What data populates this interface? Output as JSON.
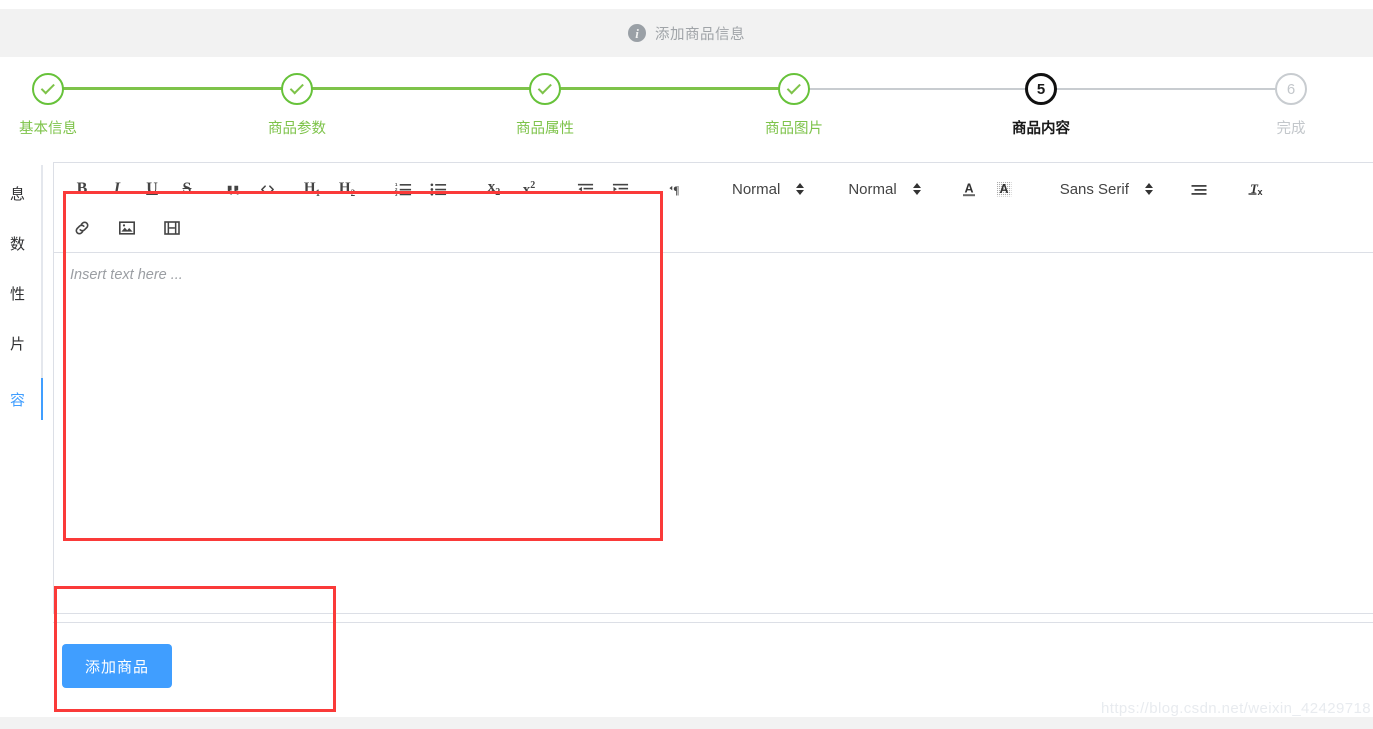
{
  "header": {
    "icon": "info-icon",
    "title": "添加商品信息"
  },
  "steps": [
    {
      "index": "1",
      "label": "基本信息",
      "state": "done"
    },
    {
      "index": "2",
      "label": "商品参数",
      "state": "done"
    },
    {
      "index": "3",
      "label": "商品属性",
      "state": "done"
    },
    {
      "index": "4",
      "label": "商品图片",
      "state": "done"
    },
    {
      "index": "5",
      "label": "商品内容",
      "state": "active"
    },
    {
      "index": "6",
      "label": "完成",
      "state": "pending"
    }
  ],
  "sidebar": {
    "items": [
      {
        "label": "息",
        "active": false
      },
      {
        "label": "数",
        "active": false
      },
      {
        "label": "性",
        "active": false
      },
      {
        "label": "片",
        "active": false
      },
      {
        "label": "容",
        "active": true
      }
    ]
  },
  "toolbar": {
    "bold": "B",
    "italic": "I",
    "underline": "U",
    "strike": "S",
    "blockquote": "“",
    "code_block": "</>",
    "header1": "H1",
    "header2": "H2",
    "list_ordered": "ordered-list-icon",
    "list_bullet": "bullet-list-icon",
    "subscript": "x₂",
    "superscript": "x²",
    "outdent": "outdent-icon",
    "indent": "indent-icon",
    "direction": "text-direction-icon",
    "align_label": "Normal",
    "size_label": "Normal",
    "color_label": "A",
    "background_label": "A",
    "font_label": "Sans Serif",
    "align_menu": "align-icon",
    "clean": "Tx",
    "link": "link-icon",
    "image": "image-icon",
    "video": "video-icon"
  },
  "editor": {
    "placeholder": "Insert text here ..."
  },
  "actions": {
    "submit_label": "添加商品"
  },
  "watermark": {
    "text": "https://blog.csdn.net/weixin_42429718"
  },
  "colors": {
    "green": "#7ec34a",
    "blue": "#409eff",
    "red_annotation": "#fa3a39",
    "gray_line": "#c8ccd0"
  }
}
